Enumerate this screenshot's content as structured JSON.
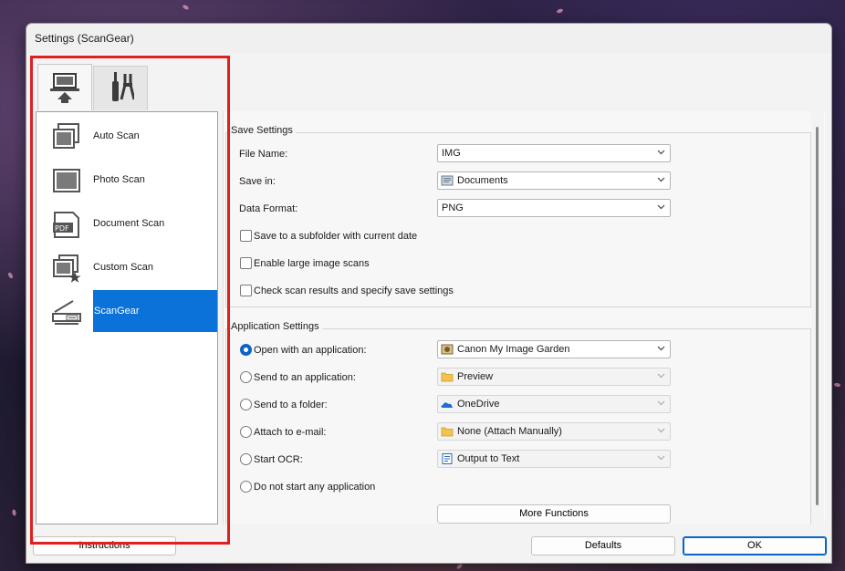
{
  "window": {
    "title": "Settings (ScanGear)"
  },
  "tabs": [
    {
      "icon": "computer-scan-icon",
      "active": true
    },
    {
      "icon": "tools-icon",
      "active": false
    }
  ],
  "nav": {
    "items": [
      {
        "label": "Auto Scan",
        "icon": "auto-scan-icon"
      },
      {
        "label": "Photo Scan",
        "icon": "photo-scan-icon"
      },
      {
        "label": "Document Scan",
        "icon": "pdf-document-icon"
      },
      {
        "label": "Custom Scan",
        "icon": "custom-scan-icon"
      },
      {
        "label": "ScanGear",
        "icon": "scanner-icon",
        "selected": true
      }
    ]
  },
  "save_settings": {
    "title": "Save Settings",
    "file_name_label": "File Name:",
    "file_name_value": "IMG",
    "save_in_label": "Save in:",
    "save_in_value": "Documents",
    "data_format_label": "Data Format:",
    "data_format_value": "PNG",
    "checkboxes": [
      {
        "label": "Save to a subfolder with current date",
        "checked": false
      },
      {
        "label": "Enable large image scans",
        "checked": false
      },
      {
        "label": "Check scan results and specify save settings",
        "checked": false
      }
    ]
  },
  "app_settings": {
    "title": "Application Settings",
    "options": [
      {
        "label": "Open with an application:",
        "value": "Canon My Image Garden",
        "icon": "image-garden-icon",
        "checked": true,
        "enabled": true
      },
      {
        "label": "Send to an application:",
        "value": "Preview",
        "icon": "folder-icon",
        "checked": false,
        "enabled": false
      },
      {
        "label": "Send to a folder:",
        "value": "OneDrive",
        "icon": "onedrive-icon",
        "checked": false,
        "enabled": false
      },
      {
        "label": "Attach to e-mail:",
        "value": "None (Attach Manually)",
        "icon": "folder-icon",
        "checked": false,
        "enabled": false
      },
      {
        "label": "Start OCR:",
        "value": "Output to Text",
        "icon": "text-document-icon",
        "checked": false,
        "enabled": false
      },
      {
        "label": "Do not start any application",
        "checked": false
      }
    ],
    "more_functions_label": "More Functions"
  },
  "buttons": {
    "instructions": "Instructions",
    "defaults": "Defaults",
    "ok": "OK"
  },
  "colors": {
    "accent": "#0a72d8",
    "highlight_box": "#e02020"
  }
}
